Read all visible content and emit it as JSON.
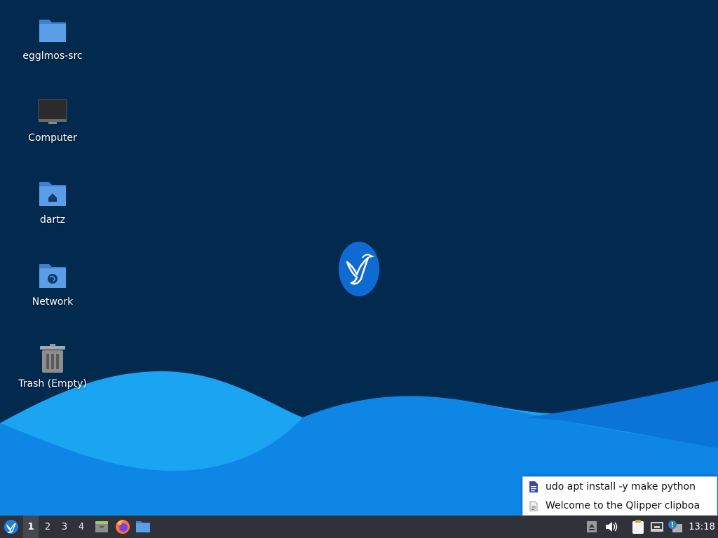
{
  "desktop": {
    "icons": [
      {
        "label": "egglmos-src",
        "icon": "folder-icon"
      },
      {
        "label": "Computer",
        "icon": "computer-icon"
      },
      {
        "label": "dartz",
        "icon": "home-folder-icon"
      },
      {
        "label": "Network",
        "icon": "network-folder-icon"
      },
      {
        "label": "Trash (Empty)",
        "icon": "trash-icon"
      }
    ],
    "center_logo": "lubuntu-logo-icon"
  },
  "clipboard_menu": {
    "items": [
      {
        "text": "udo apt install -y make python",
        "icon": "document-icon"
      },
      {
        "text": "Welcome to the Qlipper clipboa",
        "icon": "text-file-icon"
      }
    ]
  },
  "taskbar": {
    "start_icon": "lubuntu-menu-icon",
    "workspaces": [
      "1",
      "2",
      "3",
      "4"
    ],
    "active_workspace": "1",
    "launchers": [
      "show-desktop-icon",
      "firefox-icon",
      "file-manager-icon"
    ],
    "tray": [
      "eject-icon",
      "volume-icon",
      "clipboard-icon",
      "network-icon",
      "update-notifier-icon"
    ],
    "clock": "13:18"
  },
  "colors": {
    "background": "#022a4e",
    "wave_light": "#1aa0f0",
    "wave_dark": "#0a6fd6",
    "taskbar": "#2f3339",
    "folder": "#4a90d9"
  }
}
